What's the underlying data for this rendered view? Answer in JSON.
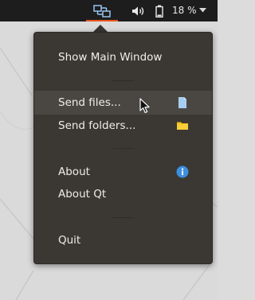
{
  "panel": {
    "battery_percent": "18 %",
    "icons": [
      "network-transfer-icon",
      "volume-icon",
      "battery-icon",
      "chevron-down-icon"
    ]
  },
  "menu": {
    "show_main_window": "Show Main Window",
    "send_files": "Send files...",
    "send_folders": "Send folders...",
    "about": "About",
    "about_qt": "About Qt",
    "quit": "Quit",
    "icons": {
      "send_files": "file-icon",
      "send_folders": "folder-icon",
      "about": "info-icon"
    }
  },
  "colors": {
    "panel_bg": "#1d1d1d",
    "menu_bg": "#3b3834",
    "menu_hover": "#4a4743",
    "accent": "#e95420",
    "info_blue": "#3d8ee0",
    "folder_yellow": "#f5c211",
    "file_blue": "#a8cdf0"
  }
}
